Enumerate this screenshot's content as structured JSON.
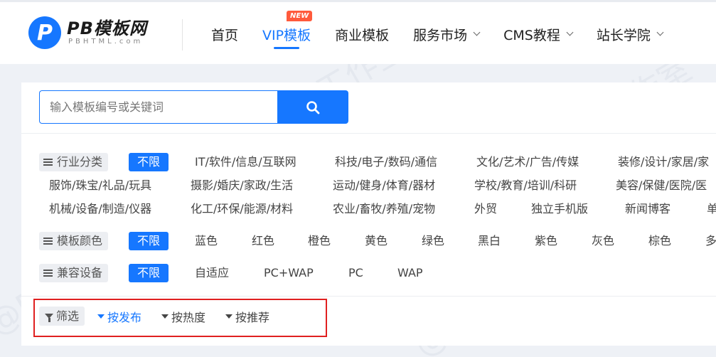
{
  "header": {
    "logo_badge": "P",
    "logo_main": "PB模板网",
    "logo_sub": "PBHTML.com",
    "nav": [
      {
        "label": "首页"
      },
      {
        "label": "VIP模板",
        "badge": "NEW"
      },
      {
        "label": "商业模板"
      },
      {
        "label": "服务市场"
      },
      {
        "label": "CMS教程"
      },
      {
        "label": "站长学院"
      }
    ]
  },
  "search": {
    "placeholder": "输入模板编号或关键词"
  },
  "filters": {
    "industry": {
      "label": "行业分类",
      "options": [
        "不限",
        "IT/软件/信息/互联网",
        "科技/电子/数码/通信",
        "文化/艺术/广告/传媒",
        "装修/设计/家居/家",
        "服饰/珠宝/礼品/玩具",
        "摄影/婚庆/家政/生活",
        "运动/健身/体育/器材",
        "学校/教育/培训/科研",
        "美容/保健/医院/医",
        "机械/设备/制造/仪器",
        "化工/环保/能源/材料",
        "农业/畜牧/养殖/宠物",
        "外贸",
        "独立手机版",
        "新闻博客",
        "单"
      ]
    },
    "color": {
      "label": "模板颜色",
      "options": [
        "不限",
        "蓝色",
        "红色",
        "橙色",
        "黄色",
        "绿色",
        "黑白",
        "紫色",
        "灰色",
        "棕色",
        "多"
      ]
    },
    "device": {
      "label": "兼容设备",
      "options": [
        "不限",
        "自适应",
        "PC+WAP",
        "PC",
        "WAP"
      ]
    }
  },
  "sort": {
    "label": "筛选",
    "items": [
      "按发布",
      "按热度",
      "按推荐"
    ],
    "active_index": 0
  },
  "watermark": "@PBHTML工作室",
  "colors": {
    "accent": "#1677ff",
    "new_badge": "#ff5a3c",
    "highlight": "#e02020"
  }
}
